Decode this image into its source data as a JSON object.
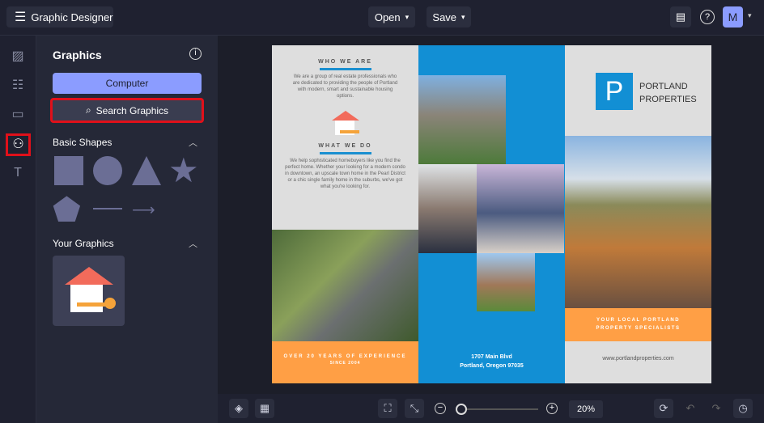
{
  "app": {
    "title": "Graphic Designer",
    "open_label": "Open",
    "save_label": "Save",
    "avatar": "M"
  },
  "panel": {
    "title": "Graphics",
    "computer_label": "Computer",
    "search_label": "Search Graphics",
    "basic_shapes": "Basic Shapes",
    "your_graphics": "Your Graphics"
  },
  "doc": {
    "who_title": "WHO WE ARE",
    "who_text": "We are a group of real estate professionals who are dedicated to providing the people of Portland with modern, smart and sustainable housing options.",
    "what_title": "WHAT WE DO",
    "what_text": "We help sophisticated homebuyers like you find the perfect home. Whether your looking for a modern condo in downtown, an upscale town home in the Pearl District or a chic single family home in the suburbs, we've got what you're looking for.",
    "experience": "OVER 20 YEARS OF EXPERIENCE",
    "since": "SINCE 2004",
    "address1": "1707 Main Blvd",
    "address2": "Portland, Oregon 97035",
    "logo_letter": "P",
    "brand1": "PORTLAND",
    "brand2": "PROPERTIES",
    "tagline1": "YOUR LOCAL PORTLAND",
    "tagline2": "PROPERTY SPECIALISTS",
    "website": "www.portlandproperties.com"
  },
  "zoom": {
    "value": "20%",
    "fraction": 0.02
  },
  "colors": {
    "accent": "#8b9cff",
    "blue": "#1a8fd0",
    "orange": "#ff9f45",
    "highlight": "#e0101a"
  }
}
